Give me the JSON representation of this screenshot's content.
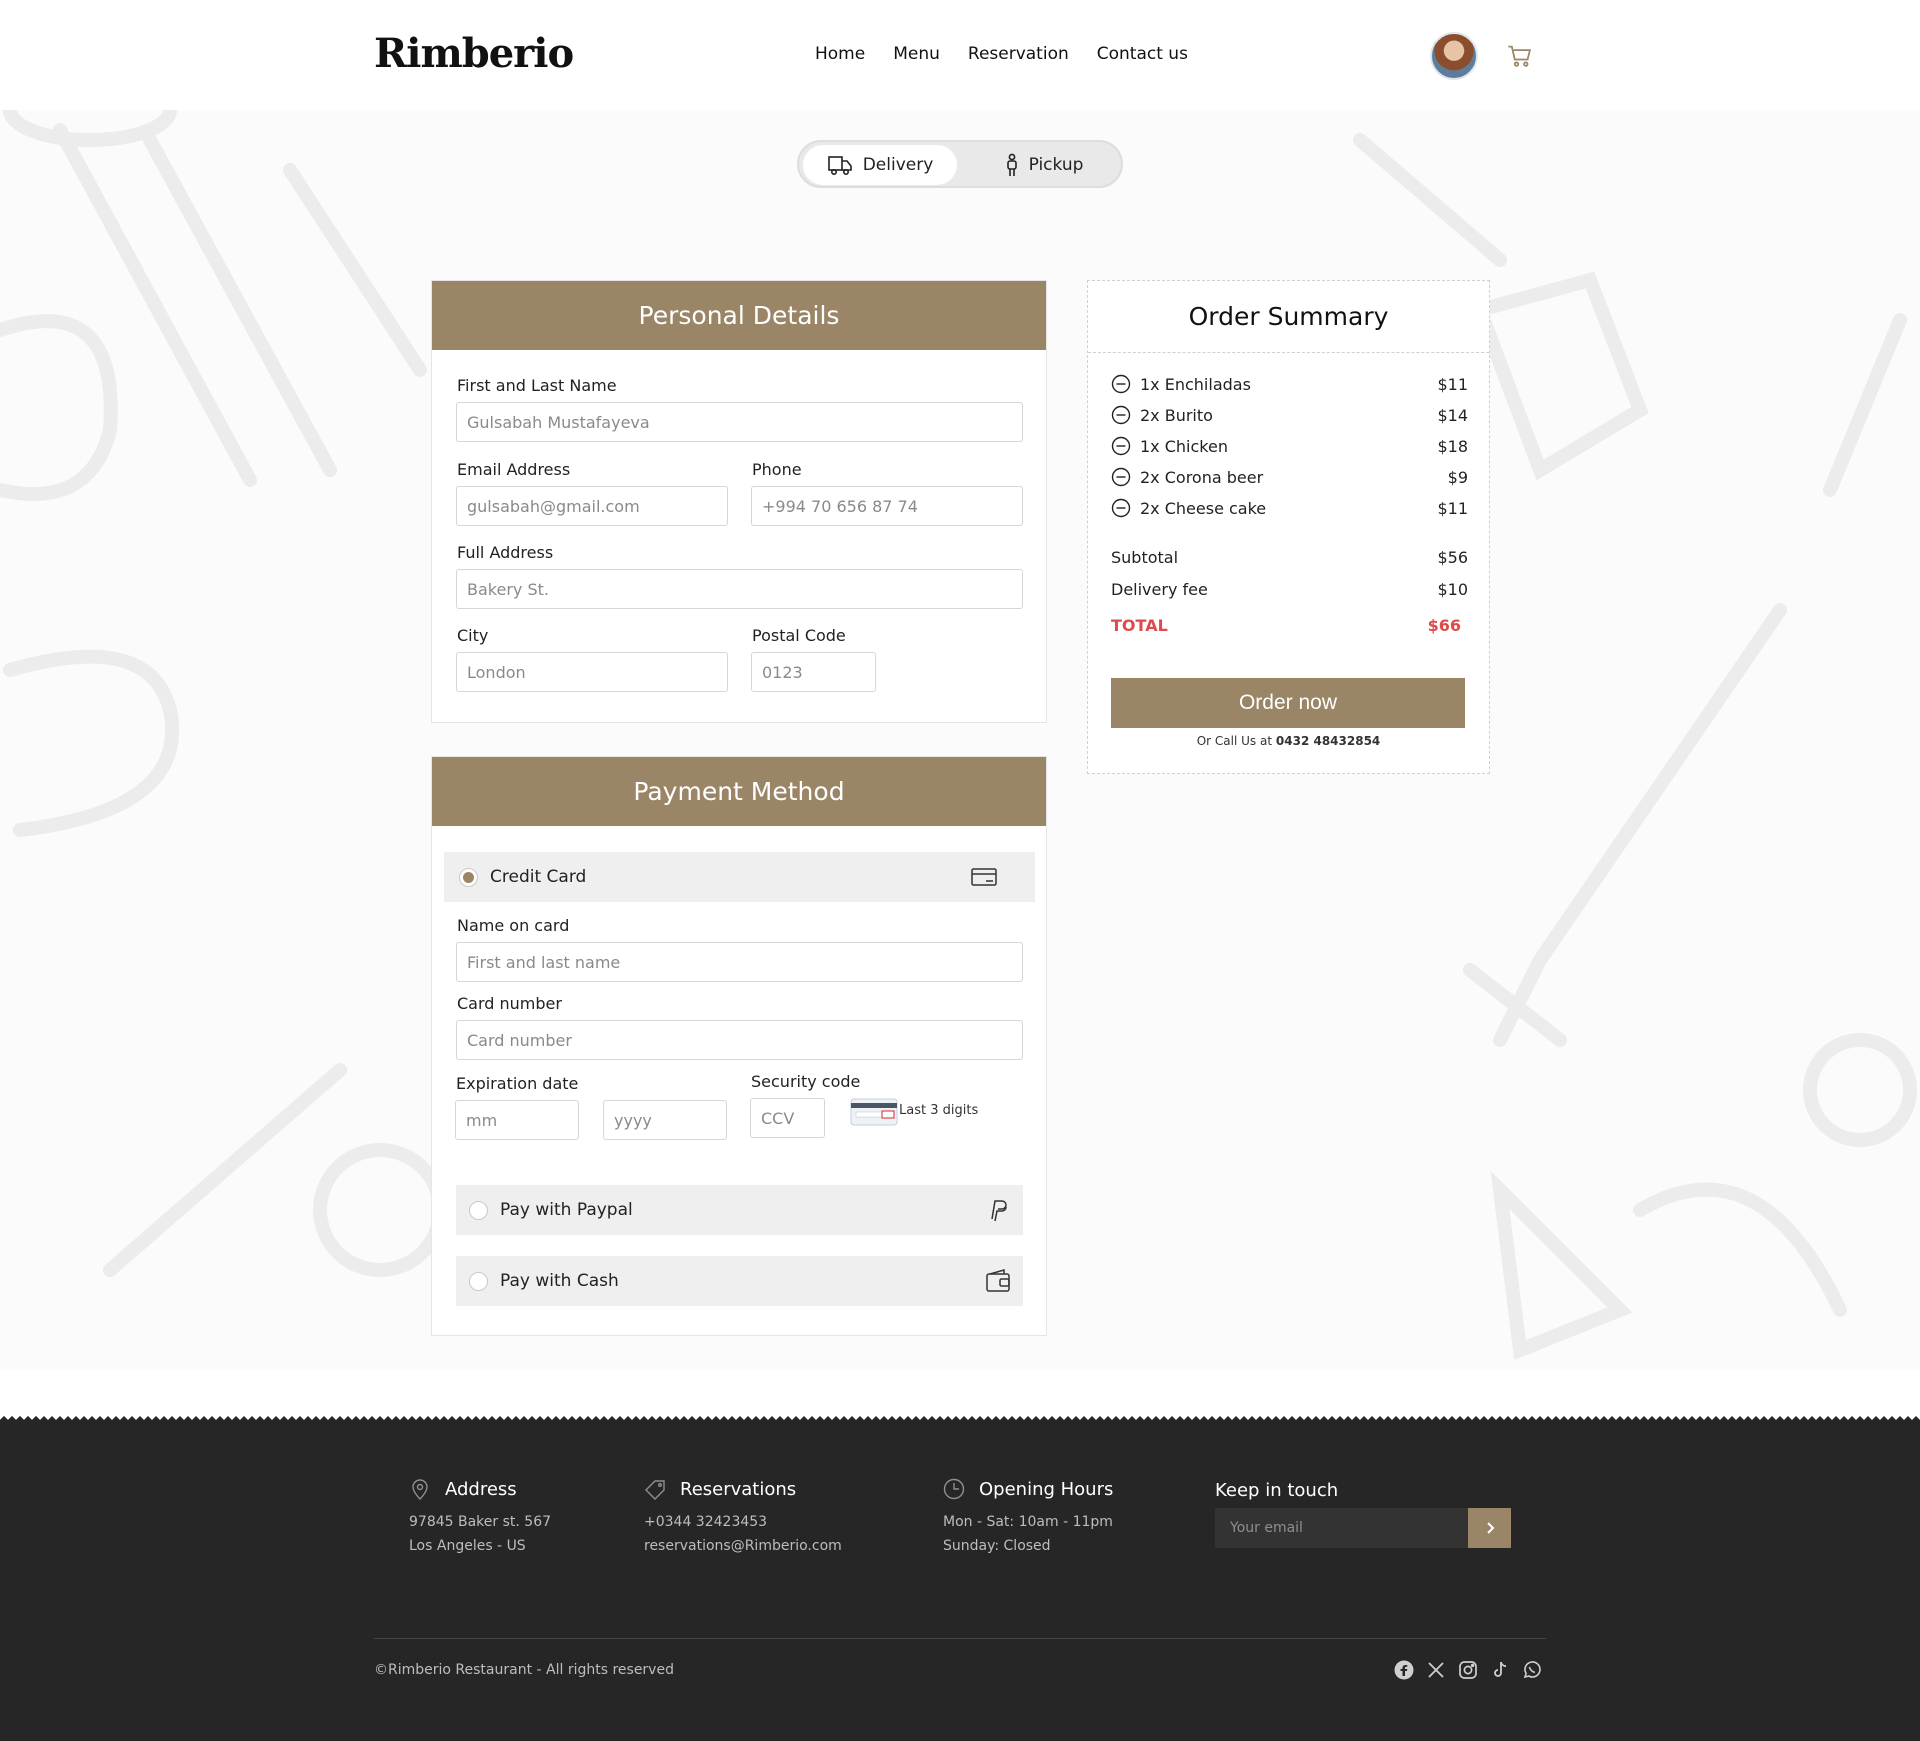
{
  "header": {
    "logo": "Rimberio",
    "nav": [
      "Home",
      "Menu",
      "Reservation",
      "Contact us"
    ]
  },
  "toggle": {
    "delivery": "Delivery",
    "pickup": "Pickup"
  },
  "personal": {
    "title": "Personal Details",
    "name_label": "First and Last Name",
    "name_value": "Gulsabah Mustafayeva",
    "email_label": "Email Address",
    "email_value": "gulsabah@gmail.com",
    "phone_label": "Phone",
    "phone_value": "+994 70 656 87 74",
    "address_label": "Full Address",
    "address_value": "Bakery St.",
    "city_label": "City",
    "city_value": "London",
    "postal_label": "Postal Code",
    "postal_value": "0123"
  },
  "payment": {
    "title": "Payment Method",
    "credit_card": "Credit Card",
    "name_on_card_label": "Name on card",
    "name_on_card_placeholder": "First and last name",
    "card_number_label": "Card number",
    "card_number_placeholder": "Card number",
    "expiration_label": "Expiration date",
    "mm_placeholder": "mm",
    "yyyy_placeholder": "yyyy",
    "security_label": "Security code",
    "ccv_placeholder": "CCV",
    "last3": "Last 3 digits",
    "paypal": "Pay with Paypal",
    "cash": "Pay with Cash"
  },
  "summary": {
    "title": "Order Summary",
    "items": [
      {
        "name": "1x Enchiladas",
        "price": "$11"
      },
      {
        "name": "2x Burito",
        "price": "$14"
      },
      {
        "name": "1x Chicken",
        "price": "$18"
      },
      {
        "name": "2x Corona beer",
        "price": "$9"
      },
      {
        "name": "2x Cheese cake",
        "price": "$11"
      }
    ],
    "subtotal_label": "Subtotal",
    "subtotal": "$56",
    "delivery_label": "Delivery fee",
    "delivery": "$10",
    "total_label": "TOTAL",
    "total": "$66",
    "order_button": "Order now",
    "call_prefix": "Or Call Us at",
    "call_number": "0432 48432854"
  },
  "footer": {
    "address_title": "Address",
    "address_line1": "97845 Baker st. 567",
    "address_line2": "Los Angeles - US",
    "reservations_title": "Reservations",
    "reservations_phone": "+0344 32423453",
    "reservations_email": "reservations@Rimberio.com",
    "hours_title": "Opening Hours",
    "hours_line1": "Mon - Sat: 10am - 11pm",
    "hours_line2": "Sunday: Closed",
    "keep_title": "Keep in touch",
    "email_placeholder": "Your email",
    "copyright": "©Rimberio Restaurant - All rights reserved"
  },
  "colors": {
    "accent": "#9a8566",
    "total": "#e04a4a",
    "footer_bg": "#262626"
  }
}
